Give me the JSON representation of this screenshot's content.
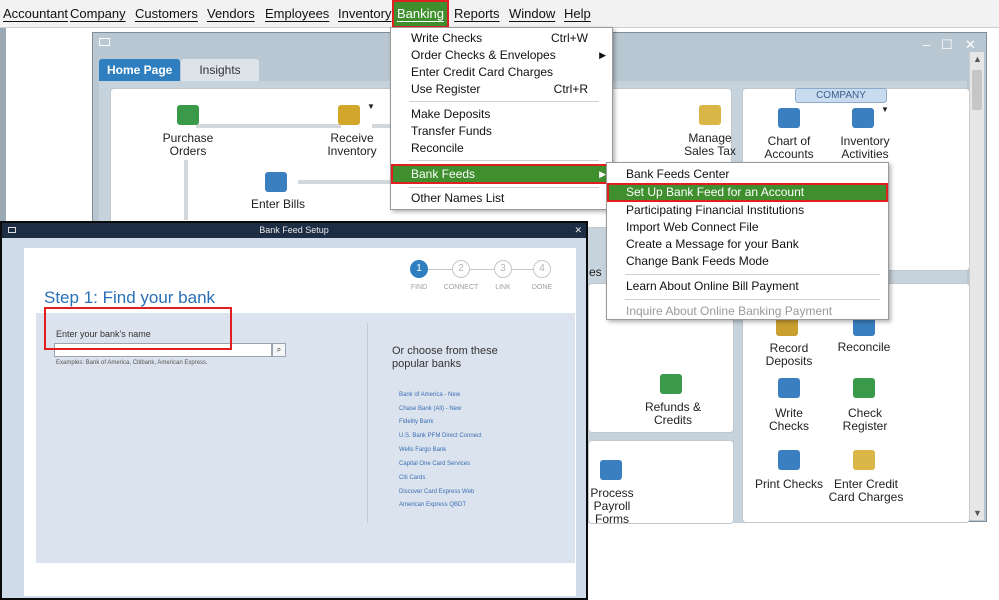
{
  "menubar": {
    "items": [
      "Accountant",
      "Company",
      "Customers",
      "Vendors",
      "Employees",
      "Inventory",
      "Banking",
      "Reports",
      "Window",
      "Help"
    ]
  },
  "home_window": {
    "tabs": [
      "Home Page",
      "Insights"
    ],
    "company_label": "COMPANY",
    "vendor_items": [
      "Purchase Orders",
      "Receive Inventory",
      "Enter Bills"
    ],
    "right_items": [
      "Manage Sales Tax",
      "Chart of Accounts",
      "Inventory Activities"
    ],
    "partial_label": "es",
    "banking_items": [
      "Record Deposits",
      "Reconcile",
      "Write Checks",
      "Check Register",
      "Print Checks",
      "Enter Credit Card Charges"
    ],
    "customer_items": [
      "Refunds & Credits"
    ],
    "employee_items": [
      "Process Payroll Forms"
    ]
  },
  "banking_menu": {
    "items": [
      {
        "label": "Write Checks",
        "shortcut": "Ctrl+W"
      },
      {
        "label": "Order Checks & Envelopes",
        "shortcut": ""
      },
      {
        "label": "Enter Credit Card Charges",
        "shortcut": ""
      },
      {
        "label": "Use Register",
        "shortcut": "Ctrl+R"
      },
      {
        "label": "Make Deposits",
        "shortcut": ""
      },
      {
        "label": "Transfer Funds",
        "shortcut": ""
      },
      {
        "label": "Reconcile",
        "shortcut": ""
      },
      {
        "label": "Bank Feeds",
        "shortcut": ""
      },
      {
        "label": "Other Names List",
        "shortcut": ""
      }
    ]
  },
  "bank_feeds_submenu": {
    "items": [
      "Bank Feeds Center",
      "Set Up Bank Feed for an Account",
      "Participating Financial Institutions",
      "Import Web Connect File",
      "Create a Message for your Bank",
      "Change Bank Feeds Mode",
      "Learn About Online Bill Payment",
      "Inquire About Online Banking Payment"
    ]
  },
  "bank_feed_setup": {
    "window_title": "Bank Feed Setup",
    "step_title": "Step 1: Find your bank",
    "steps": [
      "FIND",
      "CONNECT",
      "LINK",
      "DONE"
    ],
    "search_label": "Enter your bank's name",
    "search_value": "",
    "examples": "Examples: Bank of America, Citibank, American Express.",
    "popular_heading": "Or choose from these popular banks",
    "popular_banks": [
      "Bank of America - New",
      "Chase Bank (All) - New",
      "Fidelity Bank",
      "U.S. Bank   PFM Direct Connect",
      "Wells Fargo Bank",
      "Capital One Card Services",
      "Citi Cards",
      "Discover Card Express Web",
      "American Express QBDT"
    ]
  },
  "colors": {
    "highlight": "#3f8f2e",
    "annotation": "#e02020",
    "accent": "#2f7fc0"
  }
}
